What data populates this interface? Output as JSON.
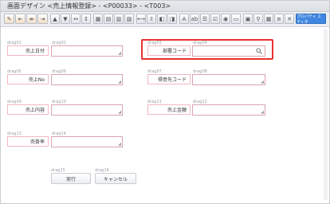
{
  "window": {
    "title": "画面デザイン <売上情報登録> - <P00033> - <T003>"
  },
  "toolbar": {
    "blue_button_label": "プロパティ エディタ"
  },
  "fields": [
    {
      "label_id": "drag01",
      "input_id": "drag02",
      "label": "売上日付"
    },
    {
      "label_id": "drag03",
      "input_id": "drag04",
      "label": "部署コード"
    },
    {
      "label_id": "drag05",
      "input_id": "drag06",
      "label": "売上No"
    },
    {
      "label_id": "drag07",
      "input_id": "drag08",
      "label": "得意先コード"
    },
    {
      "label_id": "drag09",
      "input_id": "drag10",
      "label": "売上内容"
    },
    {
      "label_id": "drag11",
      "input_id": "drag12",
      "label": "売上金額"
    },
    {
      "label_id": "drag13",
      "input_id": "drag14",
      "label": "売掛率"
    }
  ],
  "buttons": {
    "ok_id": "drag15",
    "ok_label": "実行",
    "cancel_id": "drag16",
    "cancel_label": "キャンセル"
  }
}
